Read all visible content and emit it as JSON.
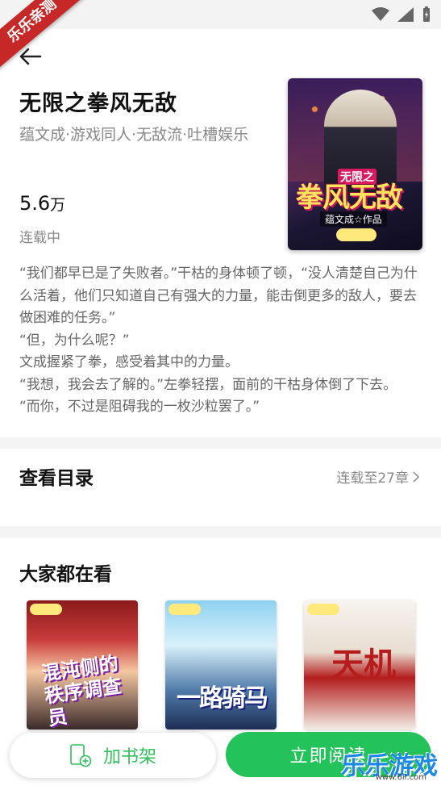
{
  "watermark": {
    "ribbon": "乐乐亲测",
    "brand": "乐乐游戏",
    "url": "www.6ll.com"
  },
  "book": {
    "title": "无限之拳风无敌",
    "tags": "蕴文成·游戏同人·无敌流·吐槽娱乐",
    "count_value": "5.6",
    "count_unit": "万",
    "status": "连载中",
    "cover": {
      "title_small": "无限之",
      "title_big": "拳风无敌",
      "author": "蕴文成☆作品"
    }
  },
  "description": [
    "“我们都早已是了失败者。”干枯的身体顿了顿，“没人清楚自己为什么活着，他们只知道自己有强大的力量，能击倒更多的敌人，要去做困难的任务。”",
    "“但，为什么呢？”",
    "文成握紧了拳，感受着其中的力量。",
    "“我想，我会去了解的。”左拳轻摆，面前的干枯身体倒了下去。",
    "“而你，不过是阻碍我的一枚沙粒罢了。”"
  ],
  "toc": {
    "title": "查看目录",
    "right": "连载至27章"
  },
  "recommend": {
    "title": "大家都在看",
    "items": [
      {
        "cover_text": "混沌侧的秩序调查员"
      },
      {
        "cover_text": "一路骑马"
      },
      {
        "cover_text": "天机"
      }
    ]
  },
  "actions": {
    "add_shelf": "加书架",
    "read_now": "立即阅读"
  },
  "colors": {
    "accent": "#24c25a",
    "ribbon": "#c62828"
  }
}
